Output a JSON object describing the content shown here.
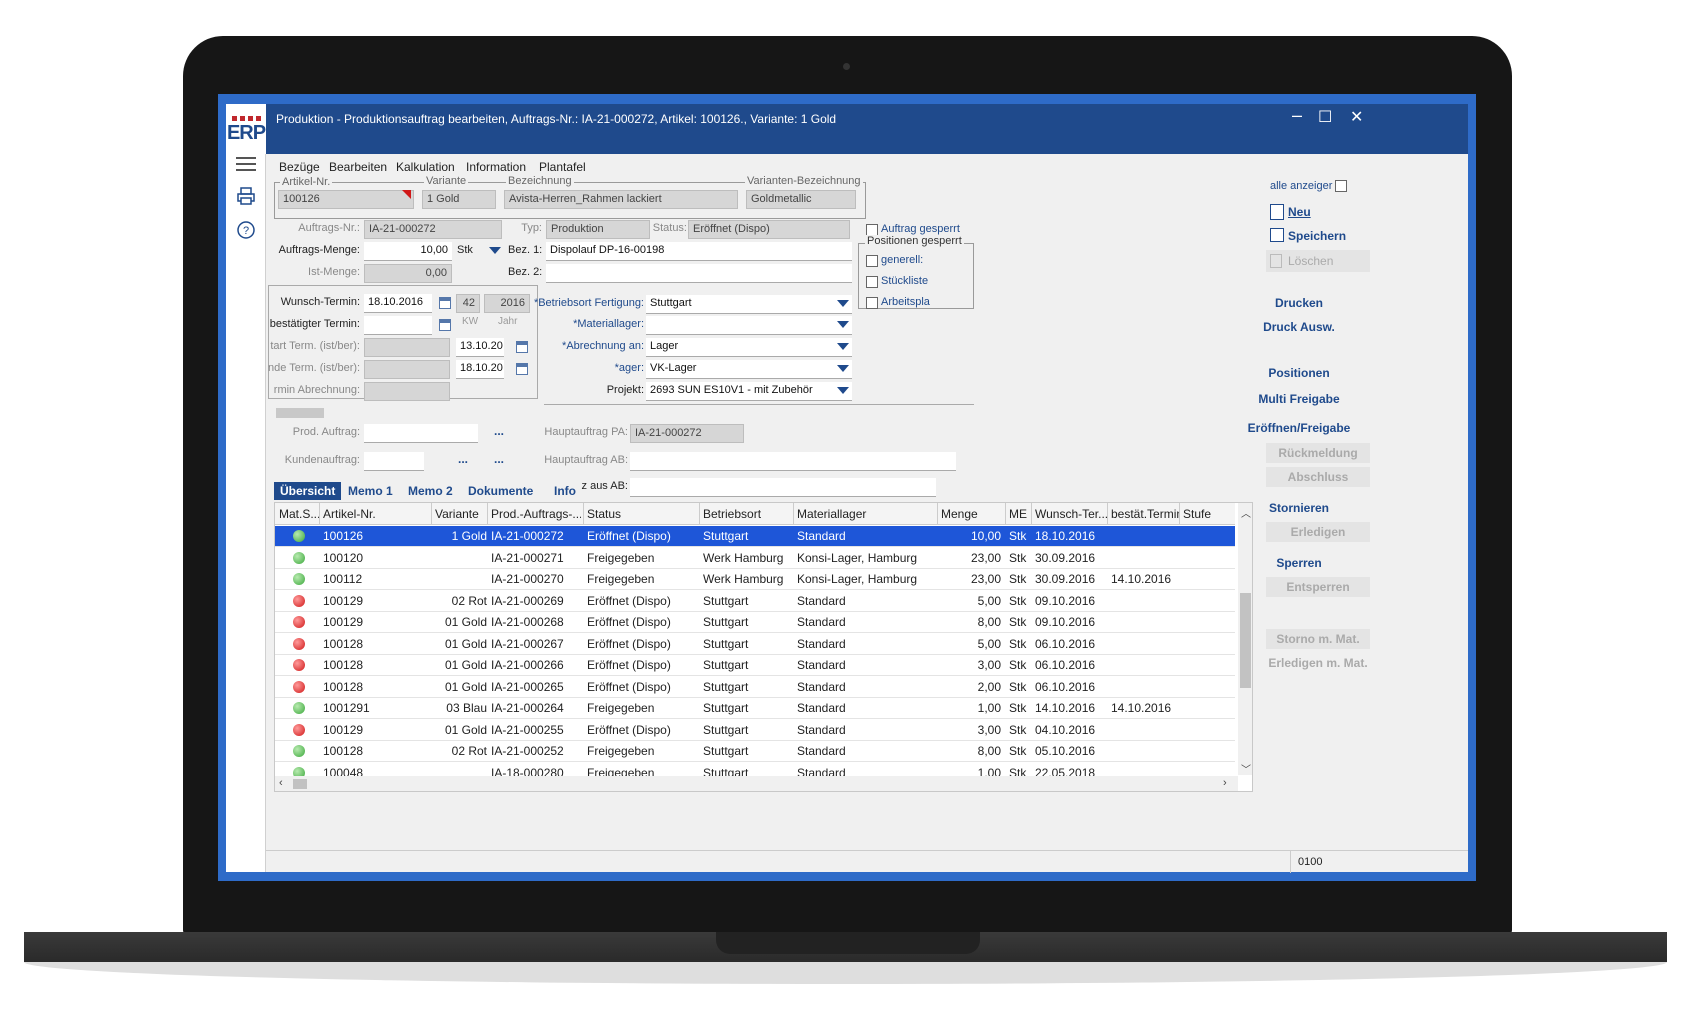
{
  "app": {
    "logo_text": "ERP",
    "window_title": "Produktion - Produktionsauftrag bearbeiten,  Auftrags-Nr.: IA-21-000272, Artikel: 100126., Variante: 1 Gold",
    "minimize": "–",
    "maximize": "☐",
    "close": "✕"
  },
  "menu": [
    "Bezüge",
    "Bearbeiten",
    "Kalkulation",
    "Information",
    "Plantafel"
  ],
  "header": {
    "artikel_label": "Artikel-Nr.",
    "artikel_value": "100126",
    "variante_label": "Variante",
    "variante_value": "1 Gold",
    "bezeichnung_label": "Bezeichnung",
    "bezeichnung_value": "Avista-Herren_Rahmen lackiert",
    "var_bez_label": "Varianten-Bezeichnung",
    "var_bez_value": "Goldmetallic"
  },
  "form": {
    "auftrags_nr_label": "Auftrags-Nr.:",
    "auftrags_nr_value": "IA-21-000272",
    "typ_label": "Typ:",
    "typ_value": "Produktion",
    "status_label": "Status:",
    "status_value": "Eröffnet (Dispo)",
    "menge_label": "Auftrags-Menge:",
    "menge_value": "10,00",
    "menge_unit": "Stk",
    "bez1_label": "Bez. 1:",
    "bez1_value": "Dispolauf DP-16-00198",
    "ist_menge_label": "Ist-Menge:",
    "ist_menge_value": "0,00",
    "bez2_label": "Bez. 2:",
    "bez2_value": "",
    "wunsch_label": "Wunsch-Termin:",
    "wunsch_value": "18.10.2016",
    "wunsch_kw": "42",
    "wunsch_jahr": "2016",
    "kw_label": "KW",
    "jahr_label": "Jahr",
    "bestaetigt_label": "bestätigter Termin:",
    "start_label": "tart Term. (ist/ber):",
    "start_value": "13.10.20",
    "ende_label": "nde Term. (ist/ber):",
    "ende_value": "18.10.20",
    "abrechnung_term_label": "rmin Abrechnung:",
    "betriebsort_label": "*Betriebsort Fertigung:",
    "betriebsort_value": "Stuttgart",
    "materiallager_label": "*Materiallager:",
    "materiallager_value": "",
    "abrechnung_label": "*Abrechnung an:",
    "abrechnung_value": "Lager",
    "lager_label": "*ager:",
    "lager_value": "VK-Lager",
    "projekt_label": "Projekt:",
    "projekt_value": "2693 SUN ES10V1 - mit Zubehör",
    "prod_auftrag_label": "Prod. Auftrag:",
    "kundenauftrag_label": "Kundenauftrag:",
    "ellipsis": "...",
    "hauptauftrag_pa_label": "Hauptauftrag PA:",
    "hauptauftrag_pa_value": "IA-21-000272",
    "hauptauftrag_ab_label": "Hauptauftrag AB:",
    "z_aus_ab_label": "z aus AB:"
  },
  "locks": {
    "auftrag_gesperrt": "Auftrag gesperrt",
    "positionen_gesperrt": "Positionen gesperrt",
    "generell": "generell:",
    "stueckliste": "Stückliste",
    "arbeitsplan": "Arbeitspla"
  },
  "actions": {
    "alle_anzeigen": "alle anzeiger",
    "neu": "Neu",
    "speichern": "Speichern",
    "loeschen": "Löschen",
    "drucken": "Drucken",
    "druck_ausw": "Druck Ausw.",
    "positionen": "Positionen",
    "multi_freigabe": "Multi Freigabe",
    "eroeffnen_freigabe": "Eröffnen/Freigabe",
    "rueckmeldung": "Rückmeldung",
    "abschluss": "Abschluss",
    "stornieren": "Stornieren",
    "erledigen": "Erledigen",
    "sperren": "Sperren",
    "entsperren": "Entsperren",
    "storno_mat": "Storno m. Mat.",
    "erledigen_mat": "Erledigen m. Mat."
  },
  "tabs": [
    "Übersicht",
    "Memo 1",
    "Memo 2",
    "Dokumente",
    "Info"
  ],
  "table": {
    "columns": [
      "Mat.S...",
      "Artikel-Nr.",
      "Variante",
      "Prod.-Auftrags-...",
      "Status",
      "Betriebsort",
      "Materiallager",
      "Menge",
      "ME",
      "Wunsch-Ter...",
      "bestät.Termin",
      "Stufe"
    ],
    "rows": [
      {
        "mat": "green",
        "artikel": "100126",
        "variante": "1 Gold",
        "auftrag": "IA-21-000272",
        "status": "Eröffnet (Dispo)",
        "betriebsort": "Stuttgart",
        "lager": "Standard",
        "menge": "10,00",
        "me": "Stk",
        "wunsch": "18.10.2016",
        "bestaet": "",
        "stufe": ""
      },
      {
        "mat": "green",
        "artikel": "100120",
        "variante": "",
        "auftrag": "IA-21-000271",
        "status": "Freigegeben",
        "betriebsort": "Werk Hamburg",
        "lager": "Konsi-Lager, Hamburg",
        "menge": "23,00",
        "me": "Stk",
        "wunsch": "30.09.2016",
        "bestaet": "",
        "stufe": ""
      },
      {
        "mat": "green",
        "artikel": "100112",
        "variante": "",
        "auftrag": "IA-21-000270",
        "status": "Freigegeben",
        "betriebsort": "Werk Hamburg",
        "lager": "Konsi-Lager, Hamburg",
        "menge": "23,00",
        "me": "Stk",
        "wunsch": "30.09.2016",
        "bestaet": "14.10.2016",
        "stufe": ""
      },
      {
        "mat": "red",
        "artikel": "100129",
        "variante": "02 Rot",
        "auftrag": "IA-21-000269",
        "status": "Eröffnet (Dispo)",
        "betriebsort": "Stuttgart",
        "lager": "Standard",
        "menge": "5,00",
        "me": "Stk",
        "wunsch": "09.10.2016",
        "bestaet": "",
        "stufe": ""
      },
      {
        "mat": "red",
        "artikel": "100129",
        "variante": "01 Gold",
        "auftrag": "IA-21-000268",
        "status": "Eröffnet (Dispo)",
        "betriebsort": "Stuttgart",
        "lager": "Standard",
        "menge": "8,00",
        "me": "Stk",
        "wunsch": "09.10.2016",
        "bestaet": "",
        "stufe": ""
      },
      {
        "mat": "red",
        "artikel": "100128",
        "variante": "01 Gold",
        "auftrag": "IA-21-000267",
        "status": "Eröffnet (Dispo)",
        "betriebsort": "Stuttgart",
        "lager": "Standard",
        "menge": "5,00",
        "me": "Stk",
        "wunsch": "06.10.2016",
        "bestaet": "",
        "stufe": ""
      },
      {
        "mat": "red",
        "artikel": "100128",
        "variante": "01 Gold",
        "auftrag": "IA-21-000266",
        "status": "Eröffnet (Dispo)",
        "betriebsort": "Stuttgart",
        "lager": "Standard",
        "menge": "3,00",
        "me": "Stk",
        "wunsch": "06.10.2016",
        "bestaet": "",
        "stufe": ""
      },
      {
        "mat": "red",
        "artikel": "100128",
        "variante": "01 Gold",
        "auftrag": "IA-21-000265",
        "status": "Eröffnet (Dispo)",
        "betriebsort": "Stuttgart",
        "lager": "Standard",
        "menge": "2,00",
        "me": "Stk",
        "wunsch": "06.10.2016",
        "bestaet": "",
        "stufe": ""
      },
      {
        "mat": "green",
        "artikel": "1001291",
        "variante": "03 Blau",
        "auftrag": "IA-21-000264",
        "status": "Freigegeben",
        "betriebsort": "Stuttgart",
        "lager": "Standard",
        "menge": "1,00",
        "me": "Stk",
        "wunsch": "14.10.2016",
        "bestaet": "14.10.2016",
        "stufe": ""
      },
      {
        "mat": "red",
        "artikel": "100129",
        "variante": "01 Gold",
        "auftrag": "IA-21-000255",
        "status": "Eröffnet (Dispo)",
        "betriebsort": "Stuttgart",
        "lager": "Standard",
        "menge": "3,00",
        "me": "Stk",
        "wunsch": "04.10.2016",
        "bestaet": "",
        "stufe": ""
      },
      {
        "mat": "green",
        "artikel": "100128",
        "variante": "02 Rot",
        "auftrag": "IA-21-000252",
        "status": "Freigegeben",
        "betriebsort": "Stuttgart",
        "lager": "Standard",
        "menge": "8,00",
        "me": "Stk",
        "wunsch": "05.10.2016",
        "bestaet": "",
        "stufe": ""
      },
      {
        "mat": "green",
        "artikel": "100048",
        "variante": "",
        "auftrag": "IA-18-000280",
        "status": "Freigegeben",
        "betriebsort": "Stuttgart",
        "lager": "Standard",
        "menge": "1,00",
        "me": "Stk",
        "wunsch": "22.05.2018",
        "bestaet": "",
        "stufe": ""
      }
    ]
  },
  "status_bar": {
    "code": "0100"
  },
  "colors": {
    "title_bar": "#1f4a8c",
    "selection": "#1e56d8",
    "accent": "#1f4a8c"
  }
}
